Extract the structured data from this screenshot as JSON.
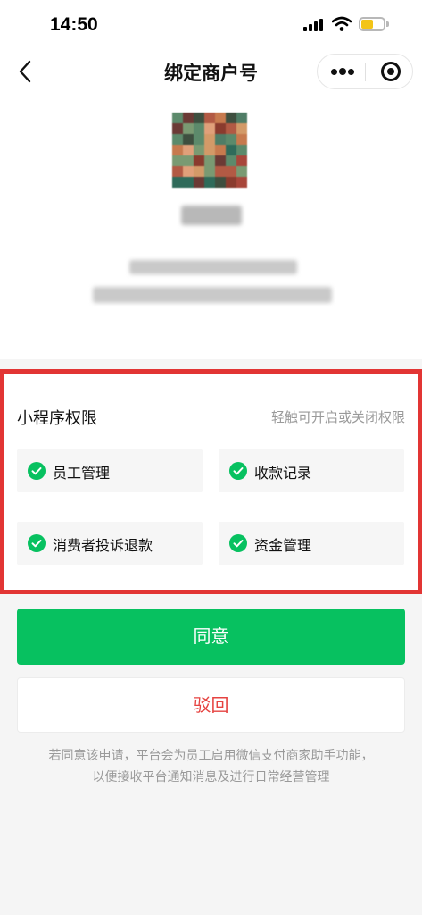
{
  "status_bar": {
    "time": "14:50",
    "icons": [
      "signal-icon",
      "wifi-icon",
      "battery-icon"
    ],
    "battery_level": 0.55,
    "battery_color": "#f3c417"
  },
  "nav": {
    "title": "绑定商户号",
    "back_icon": "chevron-left-icon",
    "more_icon": "more-dots-icon",
    "close_icon": "target-close-icon"
  },
  "permissions": {
    "title": "小程序权限",
    "hint": "轻触可开启或关闭权限",
    "items": [
      {
        "label": "员工管理",
        "enabled": true
      },
      {
        "label": "收款记录",
        "enabled": true
      },
      {
        "label": "消费者投诉退款",
        "enabled": true
      },
      {
        "label": "资金管理",
        "enabled": true
      }
    ],
    "check_icon": "check-circle-icon",
    "check_color": "#07c160",
    "highlight_color": "#e23534"
  },
  "actions": {
    "agree_label": "同意",
    "reject_label": "驳回",
    "agree_color": "#07c160",
    "reject_color": "#e64340"
  },
  "notice": {
    "line1": "若同意该申请，平台会为员工启用微信支付商家助手功能，",
    "line2": "以便接收平台通知消息及进行日常经营管理"
  }
}
